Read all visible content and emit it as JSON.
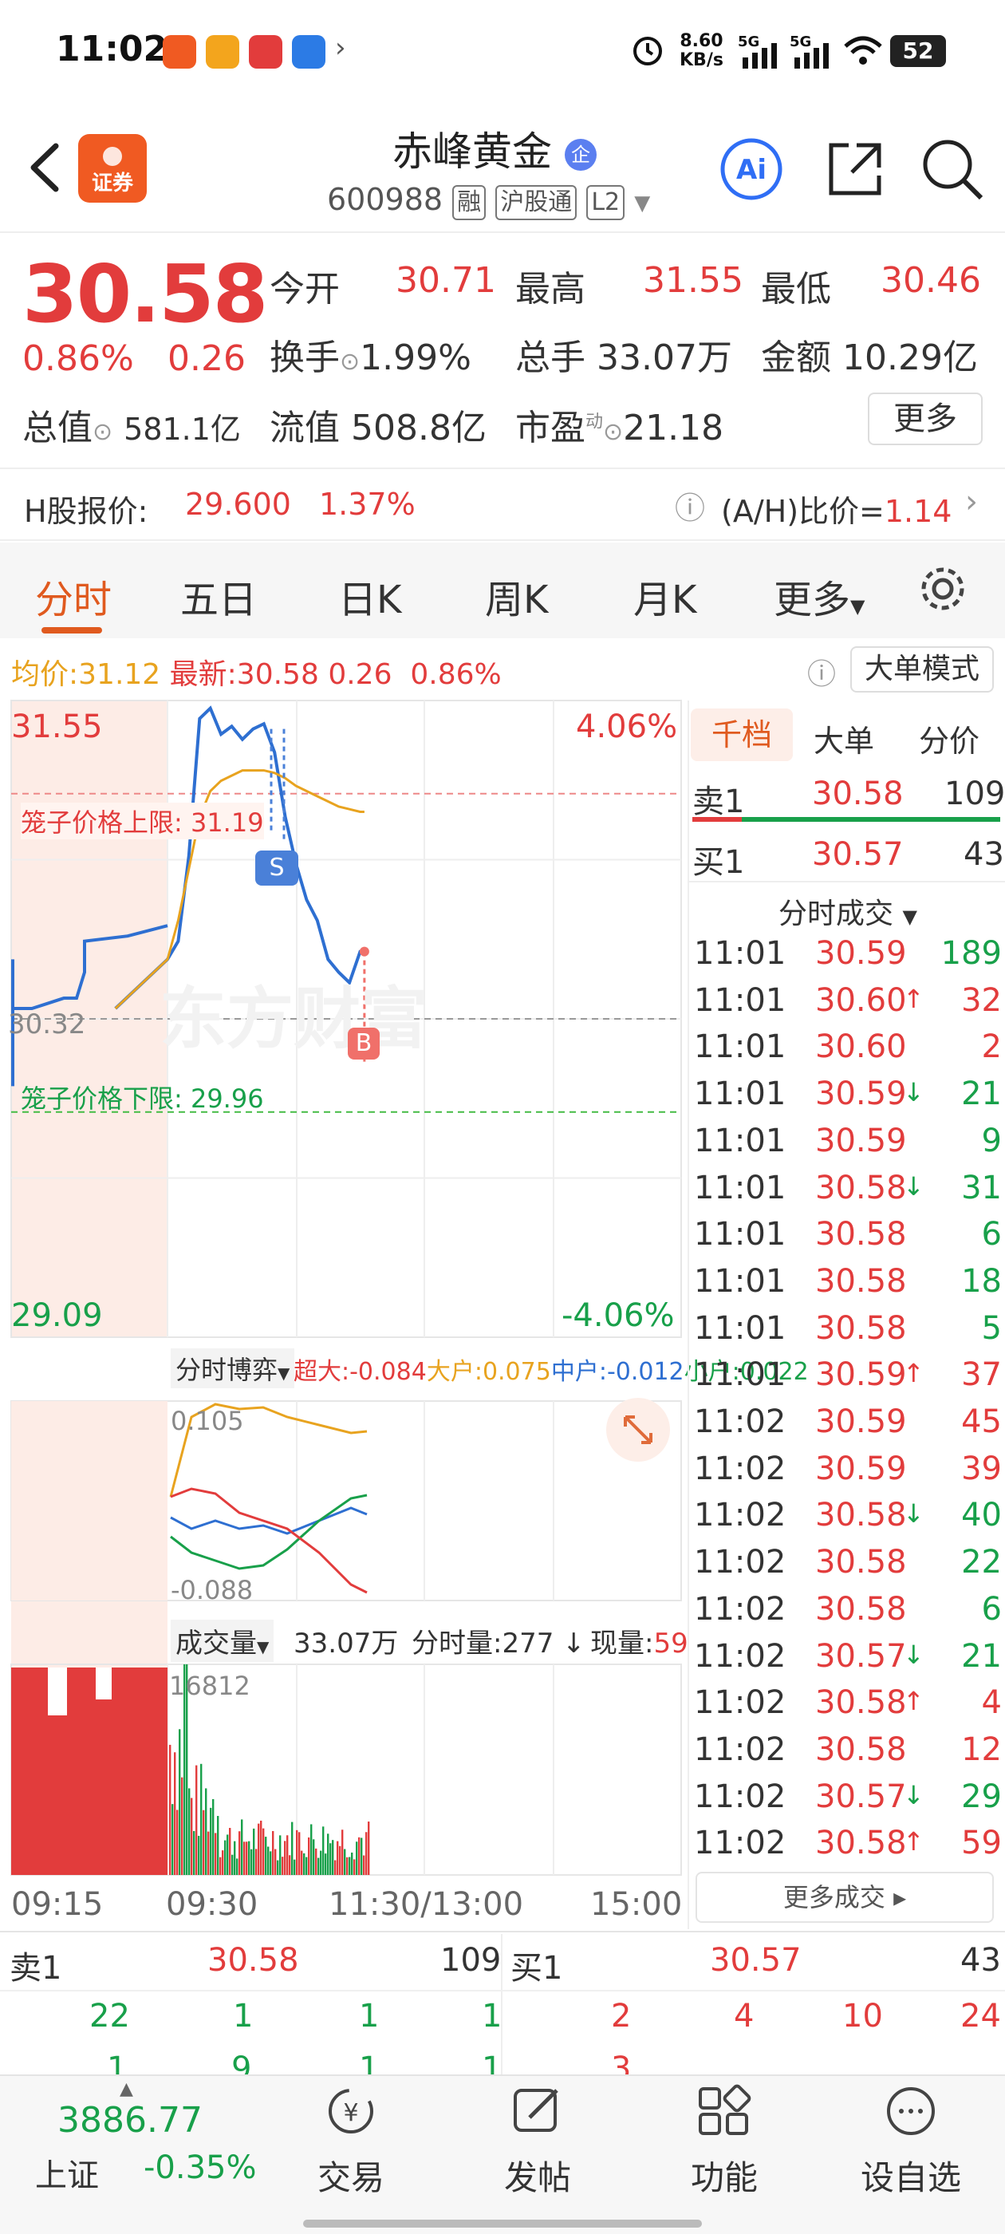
{
  "status_bar": {
    "time": "11:02",
    "speed": "8.60",
    "speed_unit": "KB/s",
    "net1": "5G",
    "net2": "5G",
    "battery": "52"
  },
  "header": {
    "name": "赤峰黄金",
    "code": "600988",
    "tags": [
      "融",
      "沪股通",
      "L2"
    ]
  },
  "quote": {
    "price": "30.58",
    "change_pct": "0.86%",
    "change": "0.26",
    "open_label": "今开",
    "open": "30.71",
    "high_label": "最高",
    "high": "31.55",
    "low_label": "最低",
    "low": "30.46",
    "turnover_label": "换手",
    "turnover": "1.99%",
    "vol_label": "总手",
    "vol": "33.07万",
    "amount_label": "金额",
    "amount": "10.29亿",
    "mcap_label": "总值",
    "mcap": "581.1亿",
    "float_label": "流值",
    "float": "508.8亿",
    "pe_label": "市盈",
    "pe_sup": "动",
    "pe": "21.18",
    "more_label": "更多"
  },
  "hshare": {
    "label": "H股报价:",
    "price": "29.600",
    "pct": "1.37%",
    "ah_label": "(A/H)比价=",
    "ah_value": "1.14"
  },
  "tabs": [
    "分时",
    "五日",
    "日K",
    "周K",
    "月K",
    "更多"
  ],
  "avg_row": {
    "avg_label": "均价:",
    "avg": "31.12",
    "latest_label": "最新:",
    "latest": "30.58",
    "chg": "0.26",
    "pct": "0.86%",
    "mode_btn": "大单模式"
  },
  "chart": {
    "y_top": "31.55",
    "y_bottom": "29.09",
    "pct_top": "4.06%",
    "pct_bottom": "-4.06%",
    "mid": "30.32",
    "upper_limit": "笼子价格上限: 31.19",
    "lower_limit": "笼子价格下限: 29.96",
    "times": [
      "09:15",
      "09:30",
      "11:30/13:00",
      "15:00"
    ],
    "marker_s": "S",
    "marker_b": "B",
    "watermark": "东方财富"
  },
  "chart_data": {
    "type": "line",
    "x": [
      "09:25",
      "09:30",
      "09:35",
      "09:40",
      "09:45",
      "09:50",
      "09:55",
      "10:00",
      "10:05",
      "10:10",
      "10:15",
      "10:20",
      "10:25",
      "10:30",
      "10:35",
      "10:40",
      "10:45",
      "10:50",
      "10:55",
      "11:00",
      "11:02"
    ],
    "series": [
      {
        "values": [
          30.36,
          30.55,
          30.62,
          30.95,
          31.48,
          31.52,
          31.42,
          31.45,
          31.4,
          31.44,
          31.46,
          31.35,
          31.1,
          30.92,
          30.78,
          30.7,
          30.55,
          30.5,
          30.46,
          30.58,
          30.58
        ]
      },
      {
        "values": [
          30.36,
          30.55,
          30.7,
          30.9,
          31.1,
          31.2,
          31.24,
          31.26,
          31.28,
          31.28,
          31.28,
          31.27,
          31.25,
          31.22,
          31.2,
          31.18,
          31.16,
          31.14,
          31.13,
          31.12,
          31.12
        ]
      }
    ],
    "ylim": [
      29.09,
      31.55
    ]
  },
  "bo": {
    "dropdown": "分时博弈",
    "super_label": "超大:",
    "super": "-0.084",
    "big_label": "大户:",
    "big": "0.075",
    "mid_label": "中户:",
    "mid": "-0.012",
    "small_label": "小户:",
    "small": "0.022",
    "top": "0.105",
    "bottom": "-0.088"
  },
  "vol": {
    "dropdown": "成交量",
    "total": "33.07万",
    "fen_label": "分时量:",
    "fen": "277",
    "now_label": "现量:",
    "now": "59",
    "peak": "16812"
  },
  "orderbook": {
    "tabs": [
      "千档",
      "大单",
      "分价"
    ],
    "sell_label": "卖1",
    "sell_price": "30.58",
    "sell_qty": "109",
    "buy_label": "买1",
    "buy_price": "30.57",
    "buy_qty": "43",
    "ticks_title": "分时成交",
    "more_btn": "更多成交"
  },
  "ticks": [
    {
      "t": "11:01",
      "p": "30.59",
      "a": "",
      "q": "189",
      "c": "green"
    },
    {
      "t": "11:01",
      "p": "30.60",
      "a": "↑",
      "q": "32",
      "c": "red"
    },
    {
      "t": "11:01",
      "p": "30.60",
      "a": "",
      "q": "2",
      "c": "red"
    },
    {
      "t": "11:01",
      "p": "30.59",
      "a": "↓",
      "q": "21",
      "c": "green"
    },
    {
      "t": "11:01",
      "p": "30.59",
      "a": "",
      "q": "9",
      "c": "green"
    },
    {
      "t": "11:01",
      "p": "30.58",
      "a": "↓",
      "q": "31",
      "c": "green"
    },
    {
      "t": "11:01",
      "p": "30.58",
      "a": "",
      "q": "6",
      "c": "green"
    },
    {
      "t": "11:01",
      "p": "30.58",
      "a": "",
      "q": "18",
      "c": "green"
    },
    {
      "t": "11:01",
      "p": "30.58",
      "a": "",
      "q": "5",
      "c": "green"
    },
    {
      "t": "11:01",
      "p": "30.59",
      "a": "↑",
      "q": "37",
      "c": "red"
    },
    {
      "t": "11:02",
      "p": "30.59",
      "a": "",
      "q": "45",
      "c": "red"
    },
    {
      "t": "11:02",
      "p": "30.59",
      "a": "",
      "q": "39",
      "c": "red"
    },
    {
      "t": "11:02",
      "p": "30.58",
      "a": "↓",
      "q": "40",
      "c": "green"
    },
    {
      "t": "11:02",
      "p": "30.58",
      "a": "",
      "q": "22",
      "c": "green"
    },
    {
      "t": "11:02",
      "p": "30.58",
      "a": "",
      "q": "6",
      "c": "green"
    },
    {
      "t": "11:02",
      "p": "30.57",
      "a": "↓",
      "q": "21",
      "c": "green"
    },
    {
      "t": "11:02",
      "p": "30.58",
      "a": "↑",
      "q": "4",
      "c": "red"
    },
    {
      "t": "11:02",
      "p": "30.58",
      "a": "",
      "q": "12",
      "c": "red"
    },
    {
      "t": "11:02",
      "p": "30.57",
      "a": "↓",
      "q": "29",
      "c": "green"
    },
    {
      "t": "11:02",
      "p": "30.58",
      "a": "↑",
      "q": "59",
      "c": "red"
    }
  ],
  "bottom_book": {
    "sell_label": "卖1",
    "sell_price": "30.58",
    "sell_qty": "109",
    "buy_label": "买1",
    "buy_price": "30.57",
    "buy_qty": "43",
    "sell_row": [
      "22",
      "1",
      "1",
      "1"
    ],
    "buy_row": [
      "2",
      "4",
      "10",
      "24"
    ],
    "sell_row2": [
      "1",
      "9",
      "1",
      "1"
    ],
    "buy_row2": [
      "3"
    ]
  },
  "nav": {
    "index_value": "3886.77",
    "index_name": "上证",
    "index_pct": "-0.35%",
    "items": [
      "交易",
      "发帖",
      "功能",
      "设自选"
    ]
  }
}
